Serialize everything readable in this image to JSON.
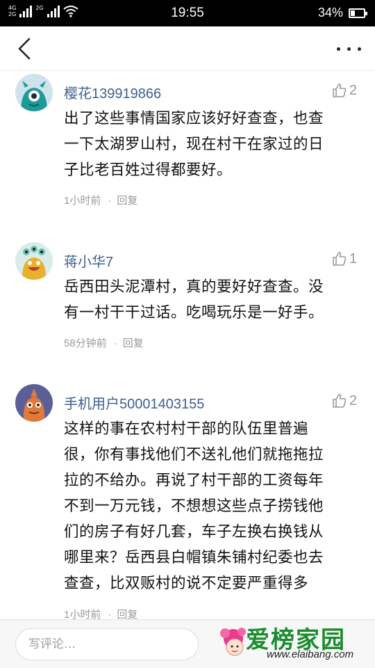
{
  "status_bar": {
    "network_1": "4G",
    "network_2": "2G",
    "network_3": "2G",
    "time": "19:55",
    "battery_percent": "34%",
    "battery_level": 0.34
  },
  "comments": [
    {
      "username": "樱花139919866",
      "likes": "2",
      "lines": [
        "出了这些事情国家应该好好查查，也查",
        "一下太湖罗山村，现在村干在家过的日",
        "子比老百姓过得都要好。"
      ],
      "time": "1小时前",
      "reply": "回复",
      "avatar": "teal-monster"
    },
    {
      "username": "蒋小华7",
      "likes": "1",
      "lines": [
        "岳西田头泥潭村，真的要好好查查。没",
        "有一村干干过话。吃喝玩乐是一好手。"
      ],
      "time": "58分钟前",
      "reply": "回复",
      "avatar": "yellow-monster"
    },
    {
      "username": "手机用户50001403155",
      "likes": "2",
      "lines": [
        "这样的事在农村村干部的队伍里普遍",
        "很，你有事找他们不送礼他们就拖拖拉",
        "拉的不给办。再说了村干部的工资每年",
        "不到一万元钱，不想想这些点子捞钱他",
        "们的房子有好几套，车子左换右换钱从",
        "哪里来？岳西县白帽镇朱铺村纪委也去",
        "查查，比双贩村的说不定要严重得多"
      ],
      "time": "1小时前",
      "reply": "回复",
      "avatar": "purple-monster"
    }
  ],
  "comment_input": {
    "placeholder": "写评论…"
  },
  "watermark": {
    "title": "爱榜家园",
    "url": "www.elaibang.com"
  }
}
